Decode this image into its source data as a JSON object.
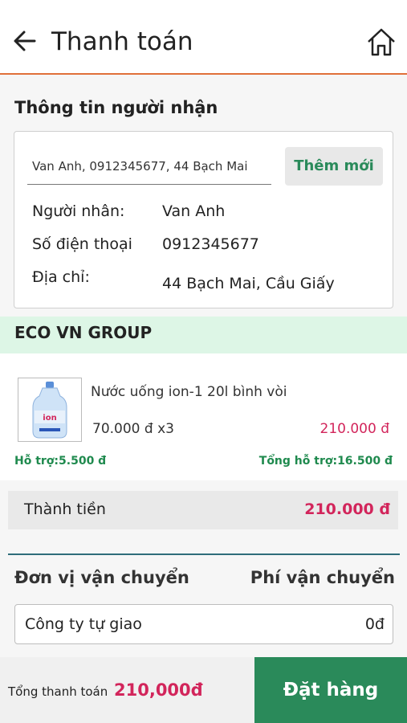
{
  "header": {
    "title": "Thanh toán",
    "back_icon": "arrow-left-icon",
    "home_icon": "home-icon"
  },
  "recipient": {
    "section_title": "Thông tin người nhận",
    "address_value": "Van Anh, 0912345677, 44 Bạch Mai",
    "add_new_label": "Thêm mới",
    "name_label": "Người nhân:",
    "name_value": "Van Anh",
    "phone_label": "Số điện thoại",
    "phone_value": "0912345677",
    "address_label": "Địa chỉ:",
    "address_detail": "44 Bạch Mai, Cầu Giấy"
  },
  "shop": {
    "name": "ECO VN GROUP"
  },
  "product": {
    "name": "Nước uống ion-1 20l bình vòi",
    "unit_price_qty": "70.000 đ x3",
    "line_total": "210.000 đ",
    "support": "Hỗ trợ:5.500 đ",
    "support_total": "Tổng hỗ trợ:16.500 đ"
  },
  "subtotal": {
    "label": "Thành tiền",
    "value": "210.000 đ"
  },
  "shipping": {
    "unit_header": "Đơn vị vận chuyển",
    "fee_header": "Phí vận chuyển",
    "selected_unit": "Công ty tự giao",
    "selected_fee": "0đ"
  },
  "footer": {
    "total_label": "Tổng thanh toán",
    "total_value": "210,000đ",
    "order_button": "Đặt hàng"
  },
  "colors": {
    "accent_green": "#2a8a5a",
    "price_red": "#d2255b",
    "header_rule": "#e0703a",
    "shop_bar": "#ddf6e6"
  }
}
